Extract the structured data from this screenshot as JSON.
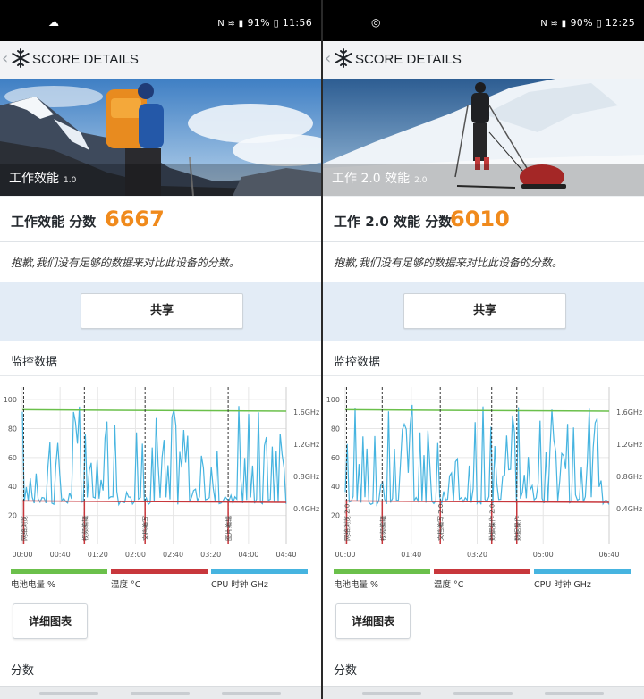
{
  "colors": {
    "battery": "#6bc04b",
    "temp": "#c8373c",
    "cpu": "#46b4e0",
    "score": "#f08a1c"
  },
  "panels": [
    {
      "status": {
        "left_icon": "cloud-icon",
        "left_glyph": "☁",
        "right_icons": "N ≋ ▮",
        "right_text": "91% ▯ 11:56"
      },
      "appbar": {
        "title": "SCORE DETAILS"
      },
      "hero": {
        "label": "工作效能",
        "version": "1.0",
        "scene": "hiker-mountains"
      },
      "score": {
        "label": "工作效能 分数",
        "value": "6667"
      },
      "message": "抱歉,我们没有足够的数据来对比此设备的分数。",
      "share_label": "共享",
      "monitor": {
        "title": "监控数据",
        "y_left": [
          "100",
          "80",
          "60",
          "40",
          "20"
        ],
        "y_right": [
          "1.6GHz",
          "1.2GHz",
          "0.8GHz",
          "0.4GHz"
        ],
        "x_labels": [
          "00:00",
          "00:40",
          "01:20",
          "02:00",
          "02:40",
          "03:20",
          "04:00",
          "04:40"
        ],
        "markers": [
          "网络浏览",
          "视频编辑",
          "文档编写",
          "图片编辑"
        ],
        "legend": {
          "battery": "电池电量 %",
          "temp": "温度 °C",
          "cpu": "CPU 时钟 GHz"
        }
      },
      "detail_label": "详细图表",
      "score_section": "分数"
    },
    {
      "status": {
        "left_icon": "circle-icon",
        "left_glyph": "◎",
        "right_icons": "N ≋ ▮",
        "right_text": "90% ▯ 12:25"
      },
      "appbar": {
        "title": "SCORE DETAILS"
      },
      "hero": {
        "label": "工作 2.0 效能",
        "version": "2.0",
        "scene": "skier-snow"
      },
      "score": {
        "label": "工作 2.0 效能 分数",
        "value": "6010"
      },
      "message": "抱歉,我们没有足够的数据来对比此设备的分数。",
      "share_label": "共享",
      "monitor": {
        "title": "监控数据",
        "y_left": [
          "100",
          "80",
          "60",
          "40",
          "20"
        ],
        "y_right": [
          "1.6GHz",
          "1.2GHz",
          "0.8GHz",
          "0.4GHz"
        ],
        "x_labels": [
          "00:00",
          "01:40",
          "03:20",
          "05:00",
          "06:40"
        ],
        "markers": [
          "网络浏览 2.0",
          "视频编辑",
          "文档编写 2.0",
          "数据操作 2.0",
          "数据操作"
        ],
        "legend": {
          "battery": "电池电量 %",
          "temp": "温度 °C",
          "cpu": "CPU 时钟 GHz"
        }
      },
      "detail_label": "详细图表",
      "score_section": "分数"
    }
  ]
}
